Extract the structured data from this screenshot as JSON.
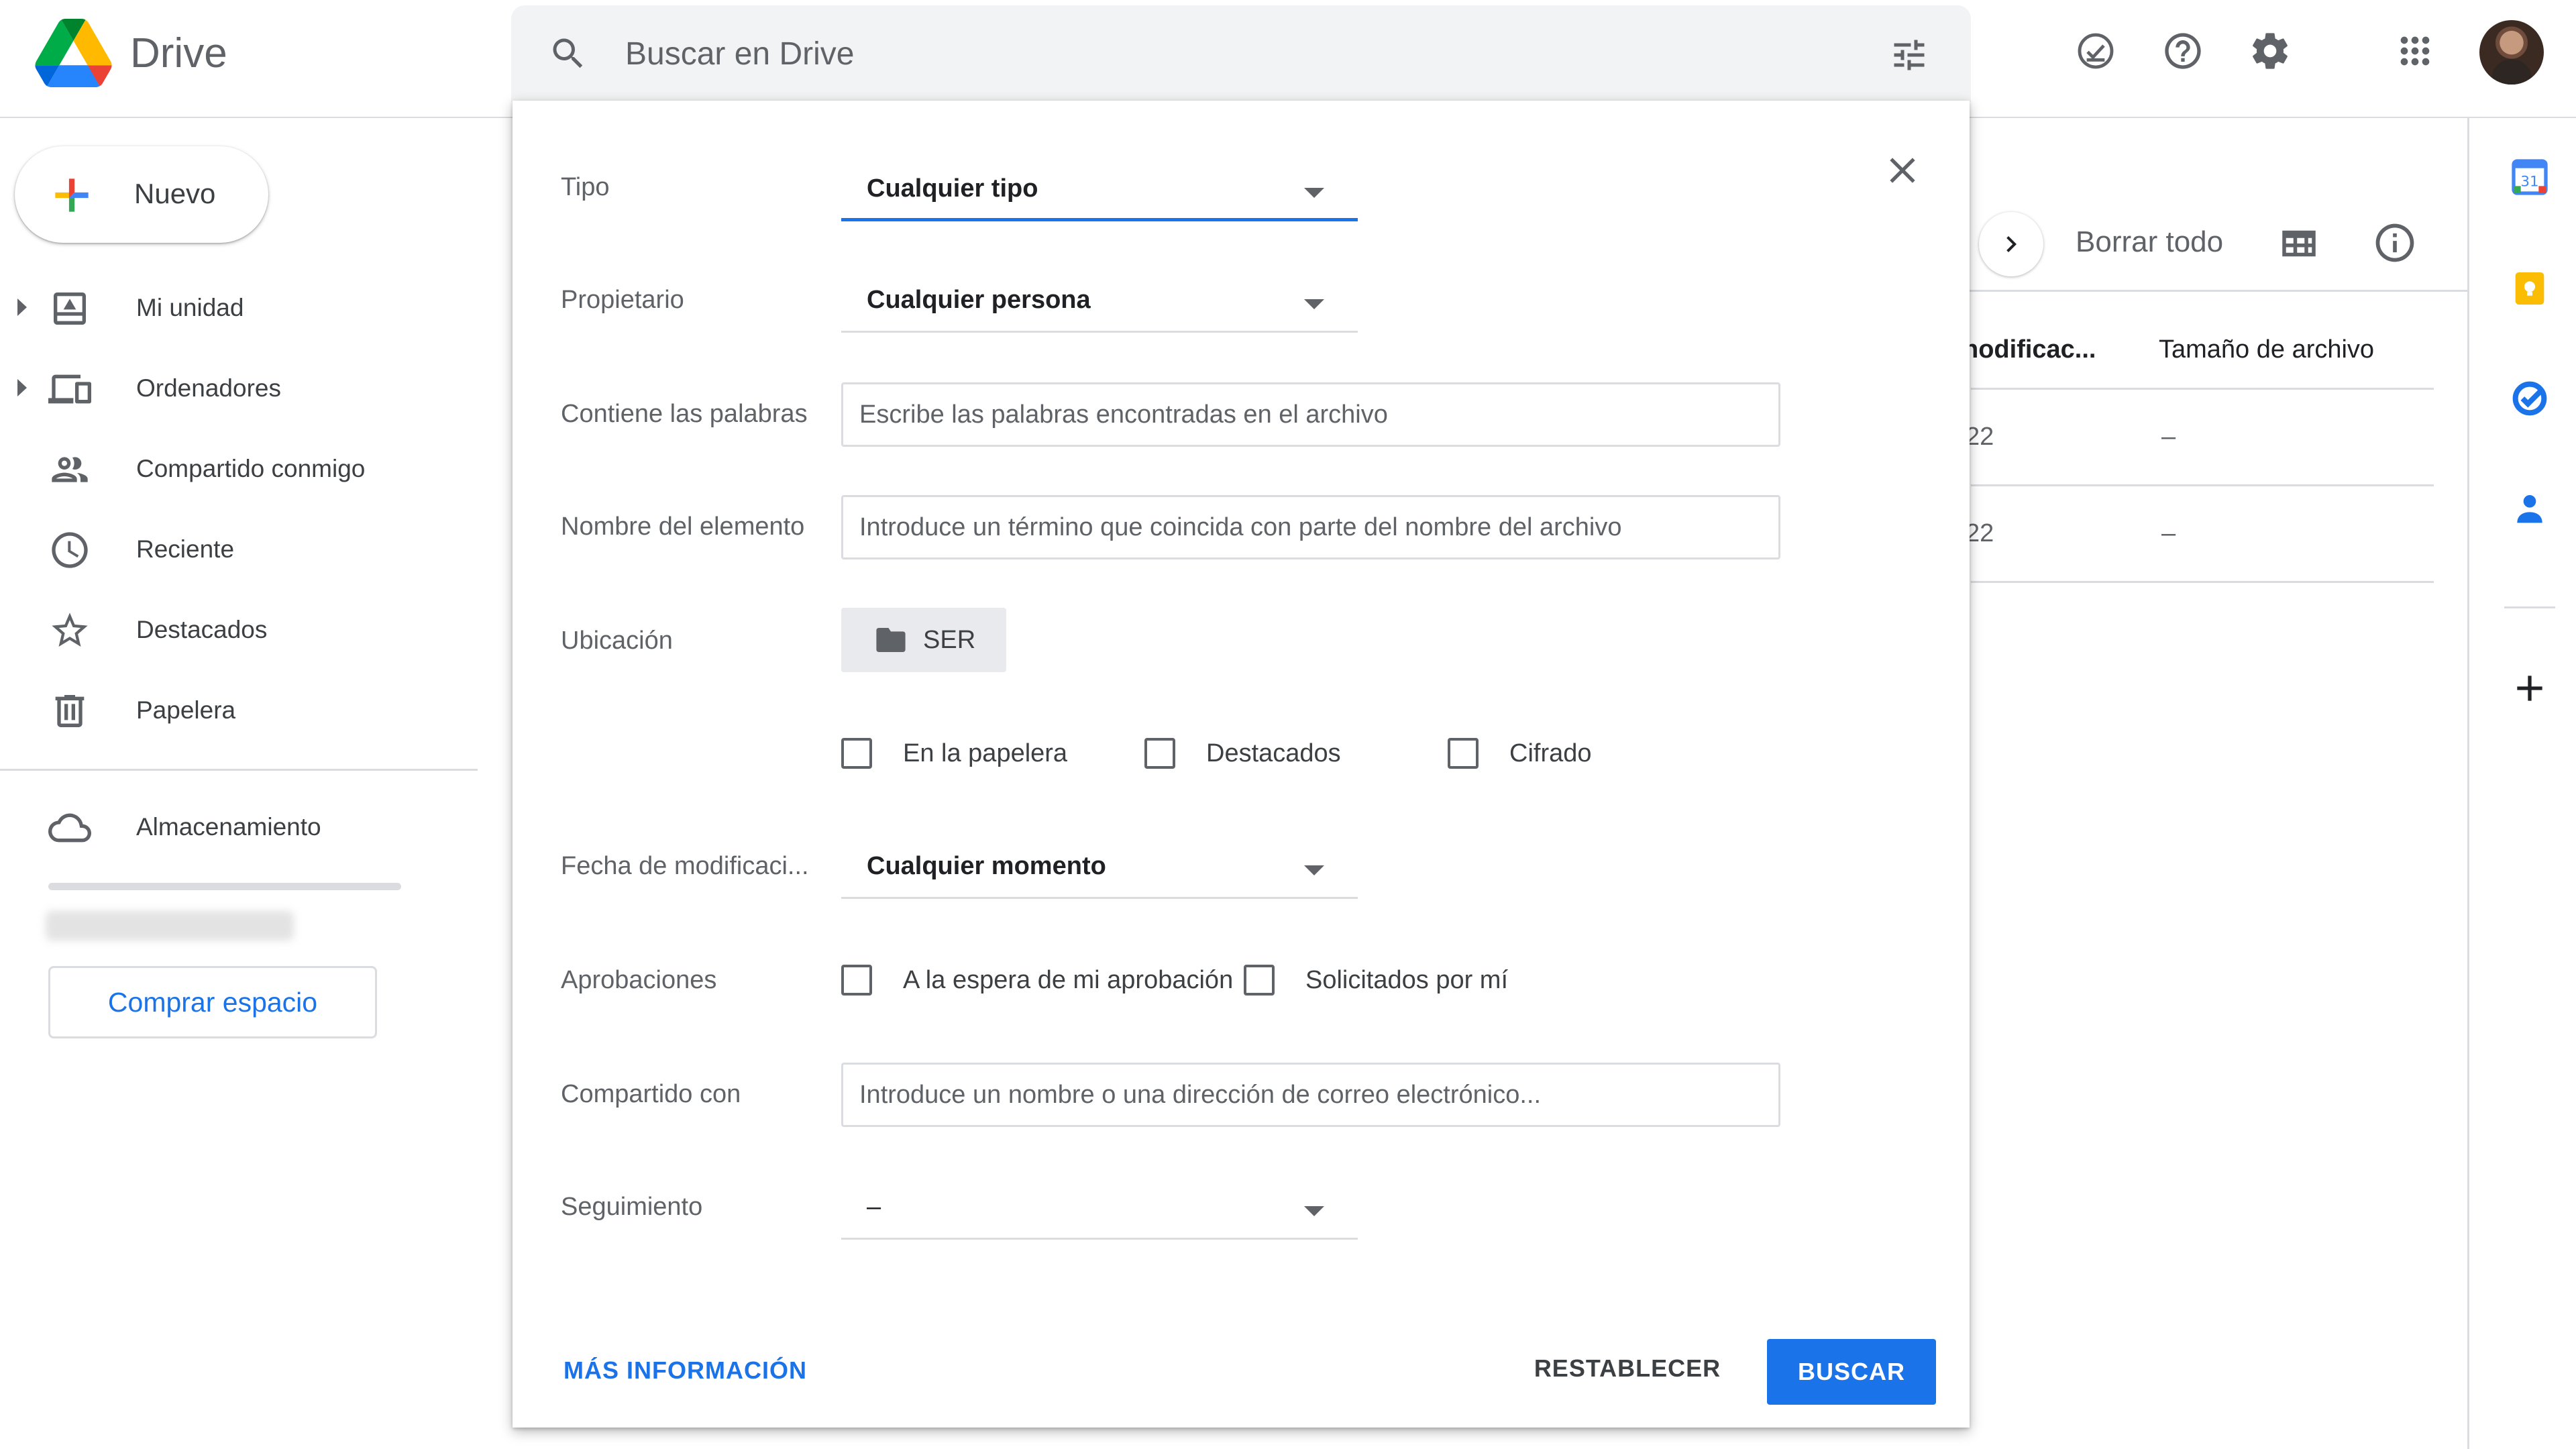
{
  "app": {
    "name": "Drive"
  },
  "search": {
    "placeholder": "Buscar en Drive"
  },
  "sidebar": {
    "new_label": "Nuevo",
    "items": [
      {
        "label": "Mi unidad",
        "icon": "my-drive-icon"
      },
      {
        "label": "Ordenadores",
        "icon": "computers-icon"
      },
      {
        "label": "Compartido conmigo",
        "icon": "shared-icon"
      },
      {
        "label": "Reciente",
        "icon": "clock-icon"
      },
      {
        "label": "Destacados",
        "icon": "star-icon"
      },
      {
        "label": "Papelera",
        "icon": "trash-icon"
      }
    ],
    "storage_label": "Almacenamiento",
    "buy_label": "Comprar espacio"
  },
  "background": {
    "clear_all": "Borrar todo",
    "col_modified": "nodificac...",
    "col_size": "Tamaño de archivo",
    "rows": [
      {
        "modified": "22",
        "size": "–"
      },
      {
        "modified": "22",
        "size": "–"
      }
    ]
  },
  "dialog": {
    "type": {
      "label": "Tipo",
      "value": "Cualquier tipo"
    },
    "owner": {
      "label": "Propietario",
      "value": "Cualquier persona"
    },
    "words": {
      "label": "Contiene las palabras",
      "placeholder": "Escribe las palabras encontradas en el archivo"
    },
    "item_name": {
      "label": "Nombre del elemento",
      "placeholder": "Introduce un término que coincida con parte del nombre del archivo"
    },
    "location": {
      "label": "Ubicación",
      "value": "SER"
    },
    "checks": {
      "trash": "En la papelera",
      "starred": "Destacados",
      "encrypted": "Cifrado"
    },
    "modified": {
      "label": "Fecha de modificaci...",
      "value": "Cualquier momento"
    },
    "approvals": {
      "label": "Aprobaciones",
      "pending": "A la espera de mi aprobación",
      "requested": "Solicitados por mí"
    },
    "shared_with": {
      "label": "Compartido con",
      "placeholder": "Introduce un nombre o una dirección de correo electrónico..."
    },
    "follow_up": {
      "label": "Seguimiento",
      "value": "–"
    },
    "more_info": "MÁS INFORMACIÓN",
    "reset": "RESTABLECER",
    "search": "BUSCAR"
  },
  "colors": {
    "accent": "#1a73e8",
    "border": "#dadce0",
    "text": "#3c4043",
    "muted": "#5f6368"
  }
}
